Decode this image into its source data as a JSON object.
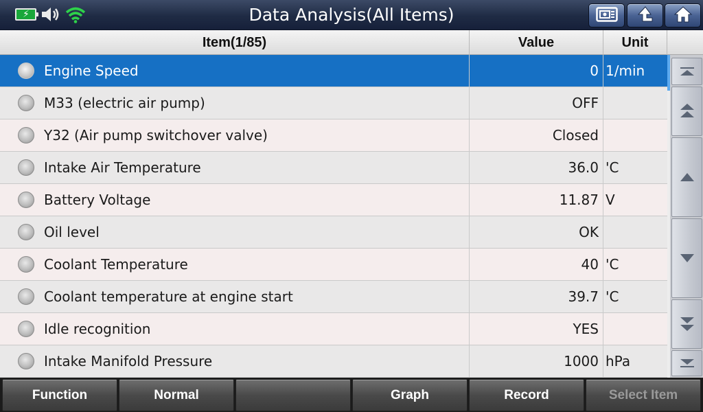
{
  "header": {
    "title": "Data Analysis(All Items)",
    "status_icons": [
      "battery-charging-icon",
      "speaker-icon",
      "wifi-icon"
    ],
    "buttons": [
      "report-icon",
      "back-icon",
      "home-icon"
    ]
  },
  "table": {
    "columns": {
      "item": "Item(1/85)",
      "value": "Value",
      "unit": "Unit"
    },
    "rows": [
      {
        "name": "Engine Speed",
        "value": "0",
        "unit": "1/min",
        "selected": true
      },
      {
        "name": "M33 (electric air pump)",
        "value": "OFF",
        "unit": ""
      },
      {
        "name": "Y32 (Air pump switchover valve)",
        "value": "Closed",
        "unit": ""
      },
      {
        "name": "Intake Air Temperature",
        "value": "36.0",
        "unit": "'C"
      },
      {
        "name": "Battery Voltage",
        "value": "11.87",
        "unit": "V"
      },
      {
        "name": "Oil level",
        "value": "OK",
        "unit": ""
      },
      {
        "name": "Coolant Temperature",
        "value": "40",
        "unit": "'C"
      },
      {
        "name": "Coolant temperature at engine start",
        "value": "39.7",
        "unit": "'C"
      },
      {
        "name": "Idle recognition",
        "value": "YES",
        "unit": ""
      },
      {
        "name": "Intake Manifold Pressure",
        "value": "1000",
        "unit": "hPa"
      }
    ]
  },
  "scroll_buttons": [
    "scroll-top-icon",
    "page-up-icon",
    "line-up-icon",
    "line-down-icon",
    "page-down-icon",
    "scroll-bottom-icon"
  ],
  "footer": {
    "buttons": [
      {
        "label": "Function",
        "enabled": true
      },
      {
        "label": "Normal",
        "enabled": true
      },
      {
        "label": "",
        "enabled": true
      },
      {
        "label": "Graph",
        "enabled": true
      },
      {
        "label": "Record",
        "enabled": true
      },
      {
        "label": "Select Item",
        "enabled": false
      }
    ]
  },
  "colors": {
    "selected_row": "#1670c4",
    "header_bar": "#1f2b44"
  }
}
